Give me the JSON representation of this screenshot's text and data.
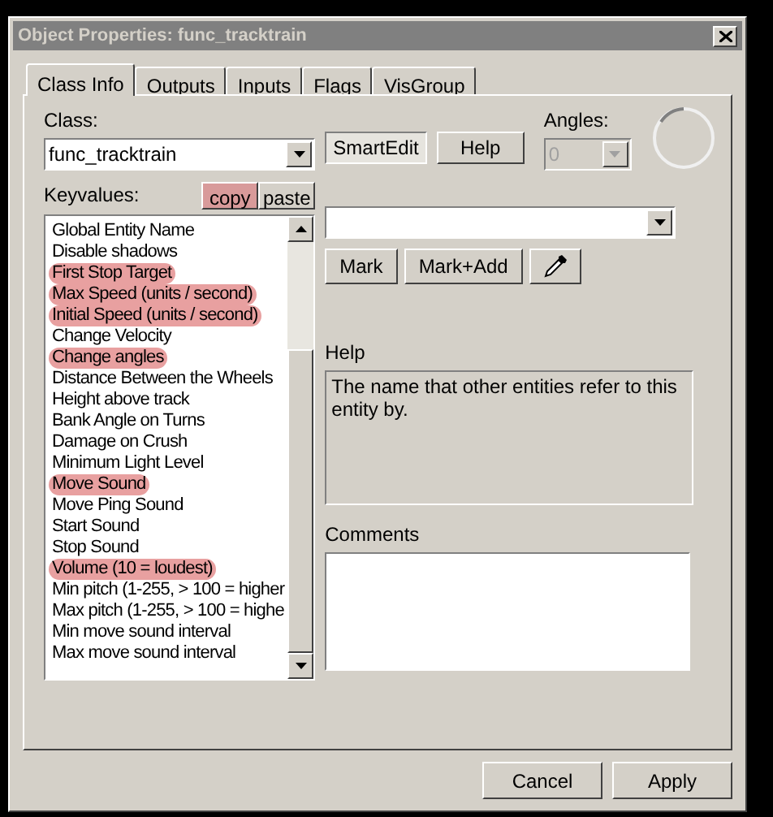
{
  "window": {
    "title": "Object Properties: func_tracktrain",
    "active": false
  },
  "tabs": [
    {
      "label": "Class Info",
      "selected": true
    },
    {
      "label": "Outputs",
      "selected": false
    },
    {
      "label": "Inputs",
      "selected": false
    },
    {
      "label": "Flags",
      "selected": false
    },
    {
      "label": "VisGroup",
      "selected": false
    }
  ],
  "class_label": "Class:",
  "class_value": "func_tracktrain",
  "smartedit_button": {
    "label": "SmartEdit",
    "pressed": true
  },
  "help_button": "Help",
  "angles": {
    "label": "Angles:",
    "value": "0",
    "disabled": true
  },
  "keyvalues_label": "Keyvalues:",
  "copy_button": {
    "label": "copy",
    "highlighted": true
  },
  "paste_button": {
    "label": "paste",
    "highlighted": false
  },
  "keyvalues": [
    {
      "label": "Global Entity Name",
      "highlighted": false
    },
    {
      "label": "Disable shadows",
      "highlighted": false
    },
    {
      "label": "First Stop Target",
      "highlighted": true
    },
    {
      "label": "Max Speed (units / second)",
      "highlighted": true
    },
    {
      "label": "Initial Speed (units / second)",
      "highlighted": true
    },
    {
      "label": "Change Velocity",
      "highlighted": false
    },
    {
      "label": "Change angles",
      "highlighted": true
    },
    {
      "label": "Distance Between the Wheels",
      "highlighted": false
    },
    {
      "label": "Height above track",
      "highlighted": false
    },
    {
      "label": "Bank Angle on Turns",
      "highlighted": false
    },
    {
      "label": "Damage on Crush",
      "highlighted": false
    },
    {
      "label": "Minimum Light Level",
      "highlighted": false
    },
    {
      "label": "Move Sound",
      "highlighted": true
    },
    {
      "label": "Move Ping Sound",
      "highlighted": false
    },
    {
      "label": "Start Sound",
      "highlighted": false
    },
    {
      "label": "Stop Sound",
      "highlighted": false
    },
    {
      "label": "Volume (10 = loudest)",
      "highlighted": true
    },
    {
      "label": "Min pitch (1-255, > 100 = higher",
      "highlighted": false
    },
    {
      "label": "Max pitch (1-255, > 100 = highe",
      "highlighted": false
    },
    {
      "label": "Min move sound interval",
      "highlighted": false
    },
    {
      "label": "Max move sound interval",
      "highlighted": false
    }
  ],
  "value_buttons": [
    "Mark",
    "Mark+Add"
  ],
  "help_label": "Help",
  "help_text": "The name that other entities refer to this entity by.",
  "comments_label": "Comments",
  "buttons": [
    "Cancel",
    "Apply"
  ]
}
